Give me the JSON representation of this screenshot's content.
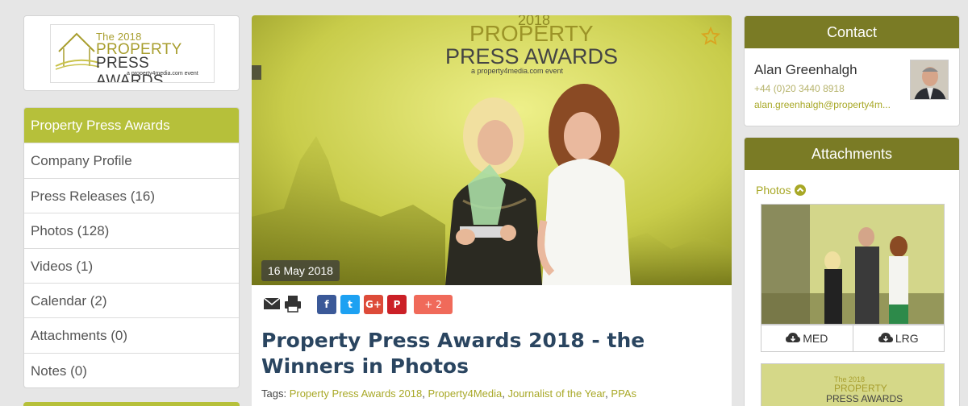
{
  "logo": {
    "year": "The 2018",
    "line1": "PROPERTY",
    "line2": "PRESS AWARDS",
    "sub": "a property4media.com event"
  },
  "nav": {
    "items": [
      {
        "label": "Property Press Awards"
      },
      {
        "label": "Company Profile"
      },
      {
        "label": "Press Releases (16)"
      },
      {
        "label": "Photos (128)"
      },
      {
        "label": "Videos (1)"
      },
      {
        "label": "Calendar (2)"
      },
      {
        "label": "Attachments (0)"
      },
      {
        "label": "Notes (0)"
      }
    ]
  },
  "article": {
    "date": "16 May 2018",
    "share_more": "+ 2",
    "title": "Property Press Awards 2018 - the Winners in Photos",
    "tags_label": "Tags:",
    "tags": [
      "Property Press Awards 2018",
      "Property4Media",
      "Journalist of the Year",
      "PPAs"
    ],
    "hero_backdrop_text": [
      "2018",
      "PROPERTY",
      "PRESS AWARDS",
      "a property4media.com event"
    ]
  },
  "contact": {
    "heading": "Contact",
    "name": "Alan Greenhalgh",
    "phone": "+44 (0)20 3440 8918",
    "email": "alan.greenhalgh@property4m..."
  },
  "attachments": {
    "heading": "Attachments",
    "photos_label": "Photos",
    "download_med": "MED",
    "download_lrg": "LRG"
  },
  "colors": {
    "accent_green": "#b6c03a",
    "header_olive": "#7a7b25",
    "link_green": "#a8a827",
    "title_blue": "#2a4560"
  }
}
